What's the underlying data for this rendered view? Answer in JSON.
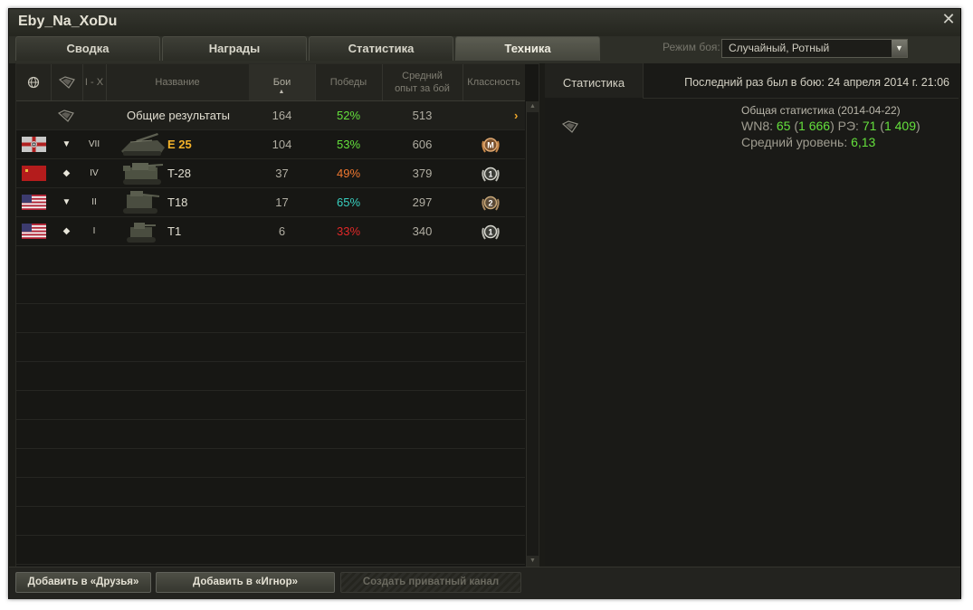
{
  "window": {
    "title": "Eby_Na_XoDu"
  },
  "tabs": [
    {
      "label": "Сводка"
    },
    {
      "label": "Награды"
    },
    {
      "label": "Статистика"
    },
    {
      "label": "Техника"
    }
  ],
  "battle_mode": {
    "label": "Режим боя:",
    "value": "Случайный, Ротный"
  },
  "table": {
    "headers": {
      "tier_range": "I - X",
      "name": "Название",
      "battles": "Бои",
      "wins": "Победы",
      "avg_xp_line1": "Средний",
      "avg_xp_line2": "опыт за бой",
      "mastery": "Классность"
    },
    "total": {
      "name": "Общие результаты",
      "battles": "164",
      "wins": "52%",
      "avg_xp": "513"
    },
    "rows": [
      {
        "nation": "germany",
        "type": "▼",
        "tier": "VII",
        "name": "E 25",
        "battles": "104",
        "wins": "53%",
        "avg_xp": "606",
        "badge": "M",
        "premium": true,
        "win_color": "#64e03c"
      },
      {
        "nation": "ussr",
        "type": "◆",
        "tier": "IV",
        "name": "T-28",
        "battles": "37",
        "wins": "49%",
        "avg_xp": "379",
        "badge": "1",
        "premium": false,
        "win_color": "#f07830"
      },
      {
        "nation": "usa",
        "type": "▼",
        "tier": "II",
        "name": "T18",
        "battles": "17",
        "wins": "65%",
        "avg_xp": "297",
        "badge": "2",
        "premium": false,
        "win_color": "#38d0c0"
      },
      {
        "nation": "usa",
        "type": "◆",
        "tier": "I",
        "name": "T1",
        "battles": "6",
        "wins": "33%",
        "avg_xp": "340",
        "badge": "1",
        "premium": false,
        "win_color": "#e02828"
      }
    ]
  },
  "right": {
    "tab_label": "Статистика",
    "last_battle": "Последний раз был в бою: 24 апреля 2014 г. 21:06",
    "general_label": "Общая статистика",
    "general_date": "(2014-04-22)",
    "wn8_label": "WN8:",
    "wn8_value": "65",
    "wn8_open": "(",
    "wn8_extra": "1 666",
    "wn8_close": ")",
    "re_label": "РЭ:",
    "re_value": "71",
    "re_open": "(",
    "re_extra": "1 409",
    "re_close": ")",
    "avg_level_label": "Средний уровень:",
    "avg_level_value": "6,13"
  },
  "footer": {
    "add_friend": "Добавить в «Друзья»",
    "add_ignore": "Добавить в «Игнор»",
    "private_channel": "Создать приватный канал"
  },
  "icons": [
    "close-icon",
    "globe-icon",
    "vehicle-type-icon",
    "dropdown-arrow-icon",
    "mastery-badge-icon",
    "flag-icon",
    "tank-icon"
  ]
}
